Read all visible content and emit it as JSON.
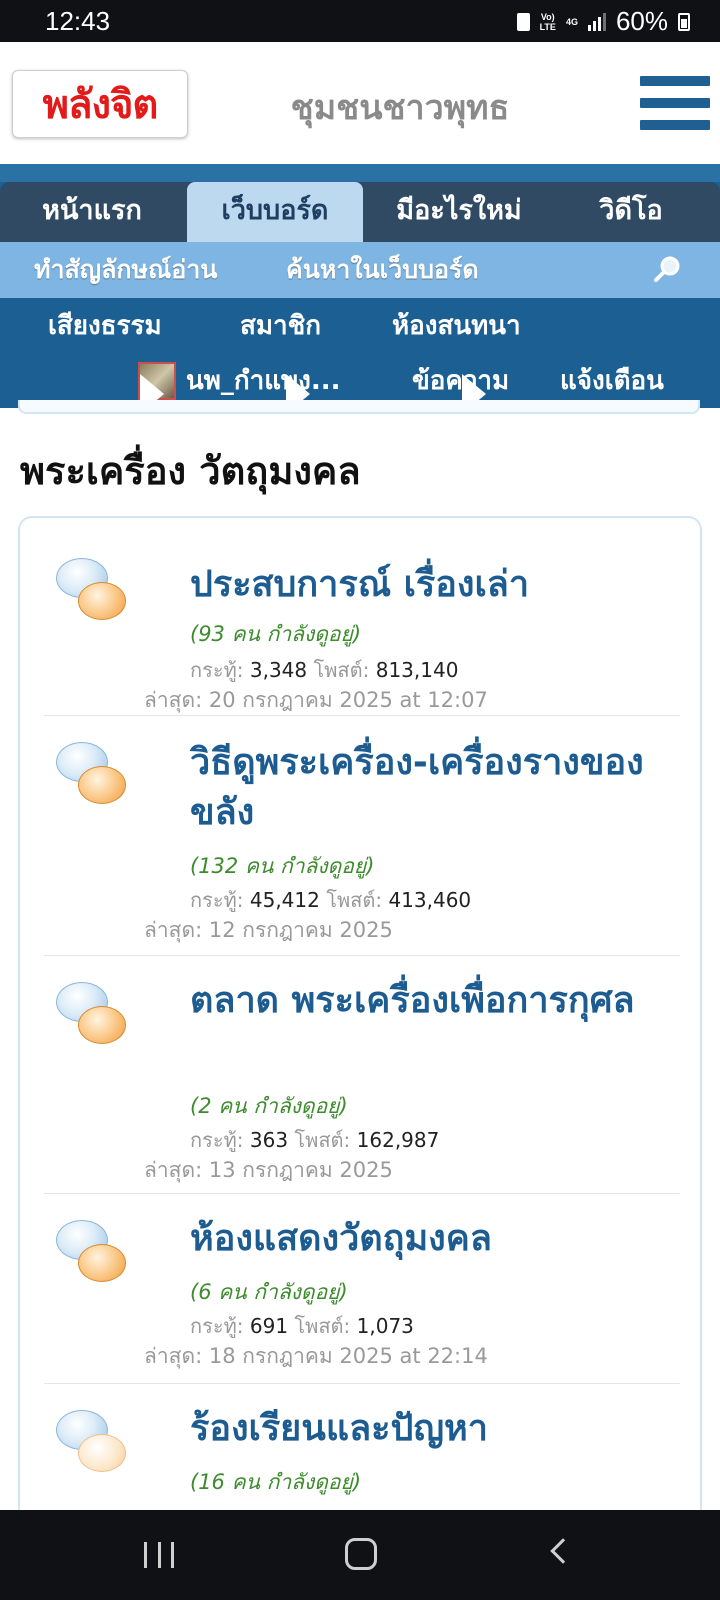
{
  "status_bar": {
    "time": "12:43",
    "network": "4G",
    "battery": "60%"
  },
  "header": {
    "logo_text": "พลังจิต",
    "site_title": "ชุมชนชาวพุทธ"
  },
  "nav": {
    "tabs": [
      {
        "label": "หน้าแรก"
      },
      {
        "label": "เว็บบอร์ด"
      },
      {
        "label": "มีอะไรใหม่"
      },
      {
        "label": "วิดีโอ"
      }
    ],
    "subnav": {
      "mark_read": "ทำสัญลักษณ์อ่าน",
      "search_label": "ค้นหาในเว็บบอร์ด"
    },
    "row3": [
      "เสียงธรรม",
      "สมาชิก",
      "ห้องสนทนา"
    ],
    "user": {
      "name": "นพ_กำแพง...",
      "messages": "ข้อความ",
      "alerts": "แจ้งเตือน"
    }
  },
  "page": {
    "title": "พระเครื่อง วัตถุมงคล"
  },
  "forums": [
    {
      "title": "ประสบการณ์ เรื่องเล่า",
      "online": "(93 คน กำลังดูอยู่)",
      "threads_label": "กระทู้:",
      "threads": "3,348",
      "posts_label": "โพสต์:",
      "posts": "813,140",
      "last": "ล่าสุด: 20 กรกฎาคม 2025 at 12:07"
    },
    {
      "title": "วิธีดูพระเครื่อง-เครื่องรางของขลัง",
      "online": "(132 คน กำลังดูอยู่)",
      "threads_label": "กระทู้:",
      "threads": "45,412",
      "posts_label": "โพสต์:",
      "posts": "413,460",
      "last": "ล่าสุด: 12 กรกฎาคม 2025"
    },
    {
      "title": "ตลาด พระเครื่องเพื่อการกุศล",
      "online": "(2 คน กำลังดูอยู่)",
      "threads_label": "กระทู้:",
      "threads": "363",
      "posts_label": "โพสต์:",
      "posts": "162,987",
      "last": "ล่าสุด: 13 กรกฎาคม 2025"
    },
    {
      "title": "ห้องแสดงวัตถุมงคล",
      "online": "(6 คน กำลังดูอยู่)",
      "threads_label": "กระทู้:",
      "threads": "691",
      "posts_label": "โพสต์:",
      "posts": "1,073",
      "last": "ล่าสุด: 18 กรกฎาคม 2025 at 22:14"
    },
    {
      "title": "ร้องเรียนและปัญหา",
      "online": "(16 คน กำลังดูอยู่)"
    }
  ],
  "colors": {
    "brand_red": "#e21a1a",
    "nav_blue": "#1c5f93",
    "link_blue": "#1d5c90",
    "online_green": "#3c8b2c"
  }
}
